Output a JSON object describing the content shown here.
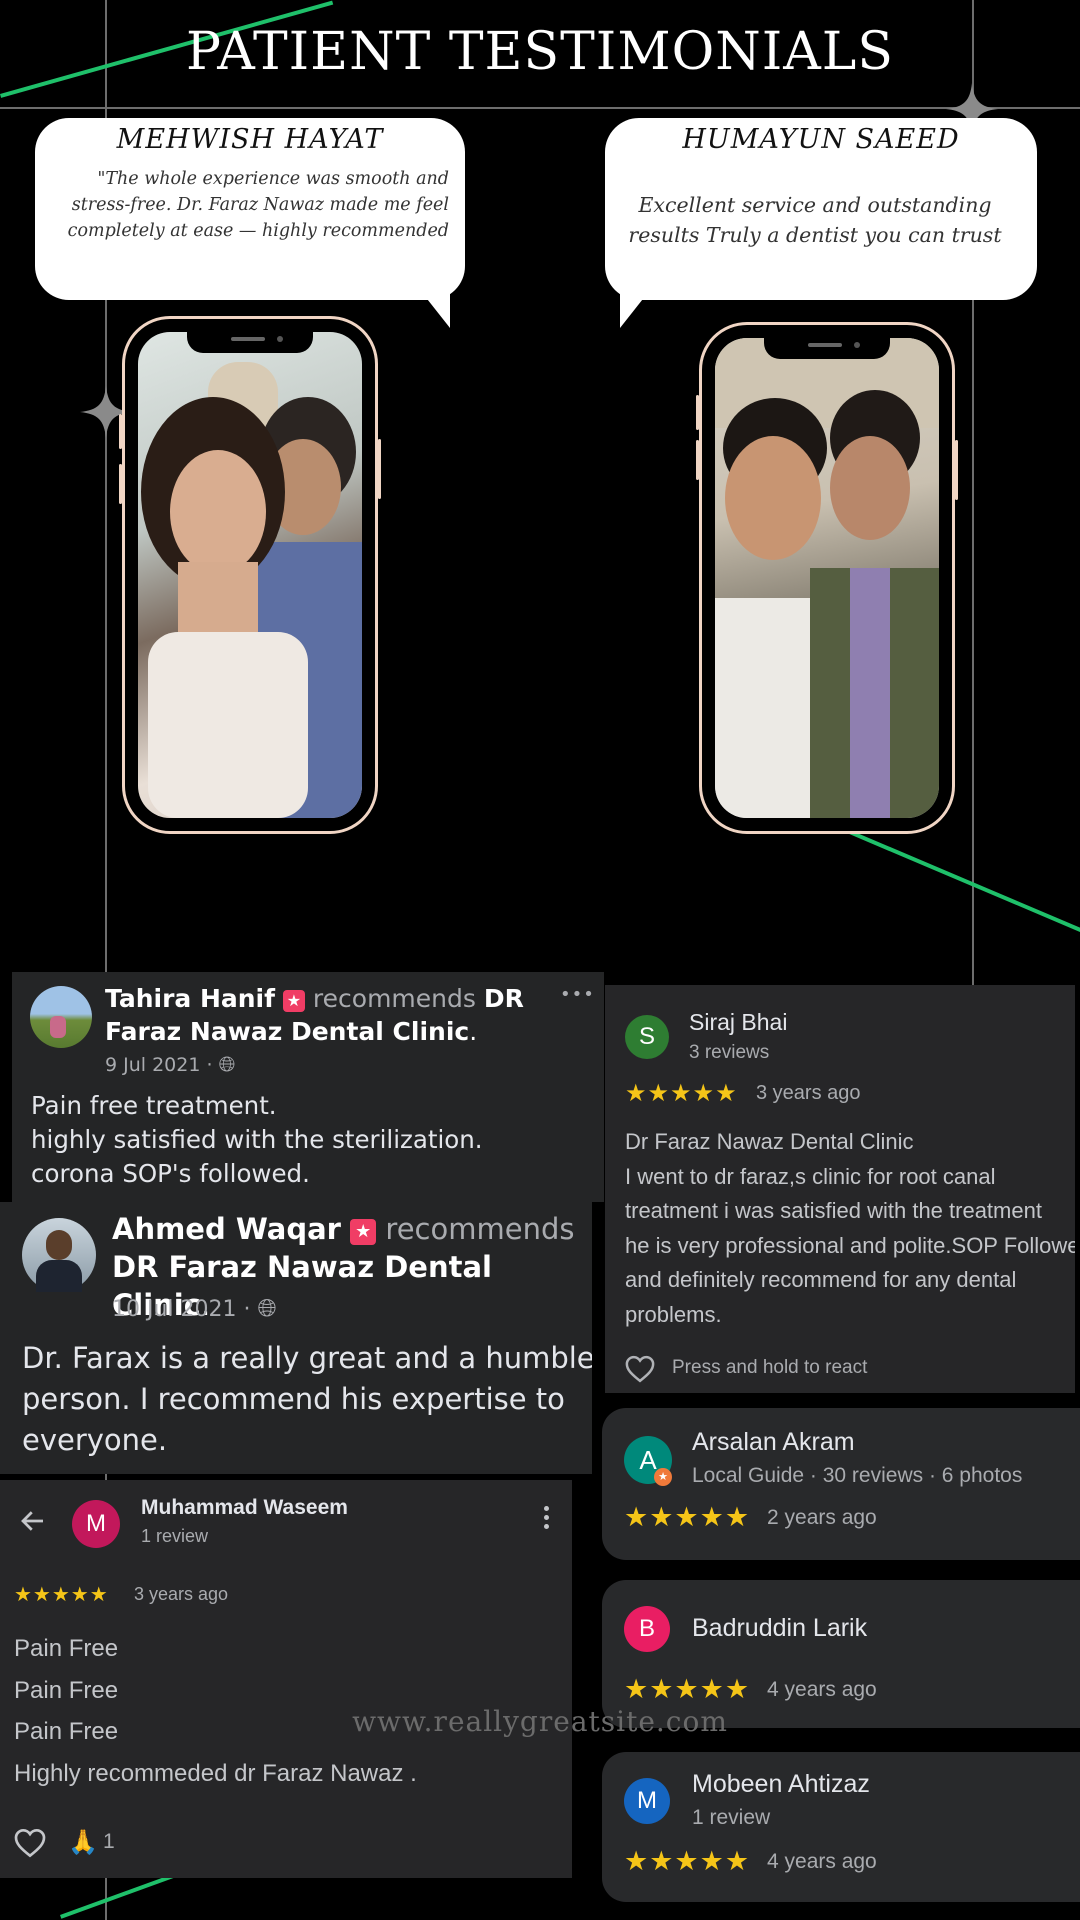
{
  "header": {
    "title": "PATIENT TESTIMONIALS"
  },
  "testimonials": [
    {
      "name": "MEHWISH HAYAT",
      "quote": "\"The whole experience was smooth and stress-free. Dr. Faraz Nawaz made me feel completely at ease — highly recommended"
    },
    {
      "name": "HUMAYUN SAEED",
      "quote": "Excellent service and outstanding results Truly a dentist you can trust"
    }
  ],
  "fb_reviews": [
    {
      "name": "Tahira Hanif",
      "recommends": "recommends",
      "page": "DR Faraz Nawaz Dental Clinic",
      "date": "9 Jul 2021 ·",
      "text": [
        "Pain free treatment.",
        "highly satisfied with the sterilization.",
        "corona SOP's followed."
      ],
      "more": "•••"
    },
    {
      "name": "Ahmed Waqar",
      "recommends": "recommends",
      "page": "DR Faraz Nawaz Dental Clinic",
      "date": "10 Jul 2021 ·",
      "text": [
        "Dr. Farax is a really great and a humble",
        "person. I recommend his expertise to",
        "everyone."
      ]
    }
  ],
  "google_reviews": {
    "siraj": {
      "initial": "S",
      "name": "Siraj Bhai",
      "meta": "3 reviews",
      "stars": "★★★★★",
      "time": "3 years ago",
      "text": [
        "Dr Faraz Nawaz Dental Clinic",
        "I went to dr faraz,s clinic for root canal",
        "treatment i was satisfied with the treatment",
        "he is very professional and polite.SOP Followed",
        "and definitely recommend for any dental",
        "problems."
      ],
      "react": "Press and hold to react",
      "color": "#2e7d32"
    },
    "waseem": {
      "initial": "M",
      "name": "Muhammad Waseem",
      "meta": "1 review",
      "stars": "★★★★★",
      "time": "3 years ago",
      "text": [
        "Pain Free",
        "Pain Free",
        "Pain Free",
        "Highly recommeded dr Faraz Nawaz ."
      ],
      "count": "1",
      "color": "#c2185b"
    },
    "arsalan": {
      "initial": "A",
      "name": "Arsalan Akram",
      "meta": "Local Guide · 30 reviews · 6 photos",
      "stars": "★★★★★",
      "time": "2 years ago",
      "color": "#00897b"
    },
    "badruddin": {
      "initial": "B",
      "name": "Badruddin Larik",
      "stars": "★★★★★",
      "time": "4 years ago",
      "color": "#e91e63"
    },
    "mobeen": {
      "initial": "M",
      "name": "Mobeen Ahtizaz",
      "meta": "1 review",
      "stars": "★★★★★",
      "time": "4 years ago",
      "color": "#1565c0"
    }
  },
  "footer": {
    "watermark": "www.reallygreatsite.com"
  }
}
